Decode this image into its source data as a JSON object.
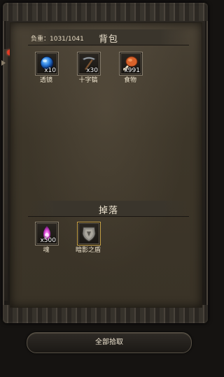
{
  "bag": {
    "title": "背包",
    "weight_label": "负重：1031/1041",
    "items": [
      {
        "name": "透镜",
        "count": "x10",
        "icon": "lens-orb-icon"
      },
      {
        "name": "十字镐",
        "count": "x30",
        "icon": "pickaxe-icon"
      },
      {
        "name": "食物",
        "count": "x991",
        "icon": "food-meat-icon"
      }
    ]
  },
  "drop": {
    "title": "掉落",
    "items": [
      {
        "name": "魂",
        "count": "x500",
        "icon": "soul-flame-icon"
      },
      {
        "name": "暗影之盾",
        "count": "",
        "icon": "shadow-shield-icon"
      }
    ]
  },
  "actions": {
    "pickup_all_label": "全部拾取"
  },
  "colors": {
    "panel": "#3d3629",
    "slot_border": "#8b8170",
    "rare_border": "#c9a44a",
    "indicator_red": "#e23a24"
  }
}
